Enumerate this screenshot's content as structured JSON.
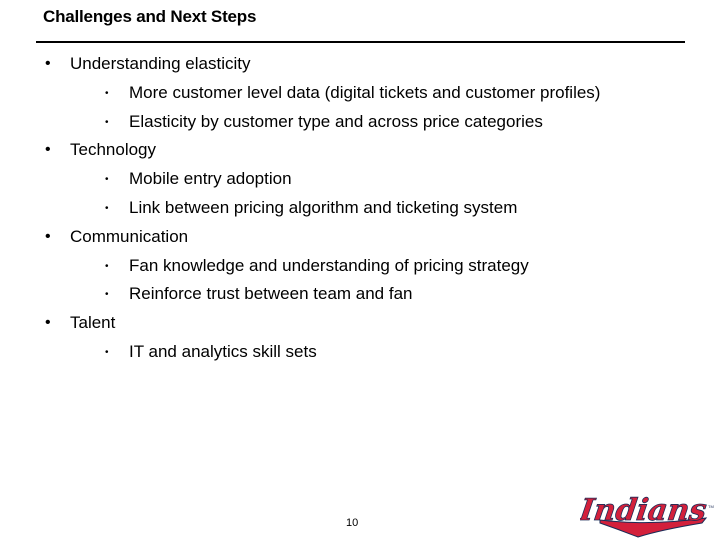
{
  "slide": {
    "title": "Challenges and Next Steps",
    "bullets": [
      {
        "text": "Understanding elasticity",
        "children": [
          "More customer level data (digital tickets and customer profiles)",
          "Elasticity by customer type and across price categories"
        ]
      },
      {
        "text": "Technology",
        "children": [
          "Mobile entry adoption",
          "Link between pricing algorithm and ticketing system"
        ]
      },
      {
        "text": "Communication",
        "children": [
          "Fan knowledge and understanding of pricing strategy",
          "Reinforce trust between team and fan"
        ]
      },
      {
        "text": "Talent",
        "children": [
          "IT and analytics skill sets"
        ]
      }
    ],
    "bullet_glyph": "•",
    "page_number": "10",
    "logo": {
      "text": "Indians",
      "trademark": "TM",
      "colors": {
        "primary": "#d3203b",
        "outline": "#1a2b56"
      }
    }
  }
}
